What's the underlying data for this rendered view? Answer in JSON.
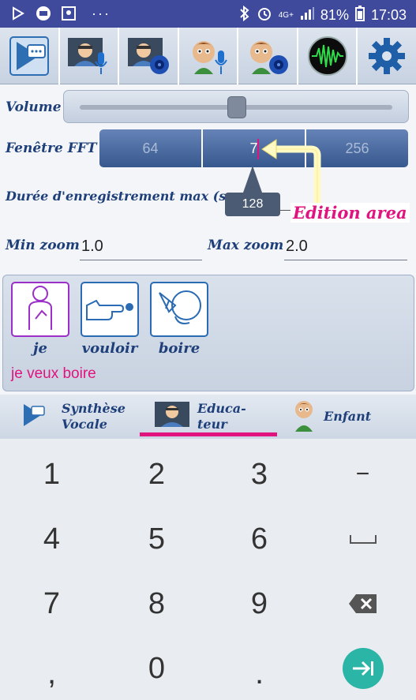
{
  "status_bar": {
    "battery": "81%",
    "time": "17:03",
    "network": "4G+",
    "icons": [
      "play-store-icon",
      "translate-app-icon",
      "gallery-icon",
      "more-notifications-icon",
      "bluetooth-icon",
      "alarm-icon",
      "signal-icon",
      "battery-icon"
    ]
  },
  "toolbar": {
    "buttons": [
      "speech-synthesis-icon",
      "educator-record-icon",
      "educator-play-icon",
      "child-record-icon",
      "child-play-icon",
      "waveform-icon",
      "settings-gear-icon"
    ]
  },
  "settings": {
    "volume_label": "Volume",
    "volume_level": 0.5,
    "fft_label": "Fenêtre FFT",
    "fft_options": [
      "64",
      "7",
      "256"
    ],
    "fft_selected": "7",
    "duration_label": "Durée d'enregistrement max (sec",
    "duration_value": "128",
    "min_zoom_label": "Min zoom",
    "min_zoom_value": "1.0",
    "max_zoom_label": "Max zoom",
    "max_zoom_value": "2.0"
  },
  "annotation": {
    "label": "Edition area",
    "color": "#e0137f"
  },
  "pictograms": {
    "cards": [
      {
        "word": "je",
        "icon": "person-pointing-self-icon",
        "border": "#9b2fc7"
      },
      {
        "word": "vouloir",
        "icon": "hand-pointing-icon",
        "border": "#2a6bb3"
      },
      {
        "word": "boire",
        "icon": "drinking-icon",
        "border": "#2a6bb3"
      }
    ],
    "sentence": "je veux boire"
  },
  "bottom_nav": {
    "tabs": [
      {
        "line1": "Synthèse",
        "line2": "Vocale",
        "icon": "speech-synthesis-icon"
      },
      {
        "line1": "Educa-",
        "line2": "teur",
        "icon": "educator-icon"
      },
      {
        "line1": "Enfant",
        "line2": "",
        "icon": "child-icon"
      }
    ],
    "active_tab": 1
  },
  "keypad": {
    "keys": [
      "1",
      "2",
      "3",
      "−",
      "4",
      "5",
      "6",
      "␣",
      "7",
      "8",
      "9",
      "⌫",
      ",",
      "0",
      ".",
      "⇥"
    ]
  },
  "colors": {
    "accent": "#e0137f",
    "label": "#1e3f79",
    "status_bar": "#3f4a9d",
    "go_key": "#2bb5a6"
  }
}
